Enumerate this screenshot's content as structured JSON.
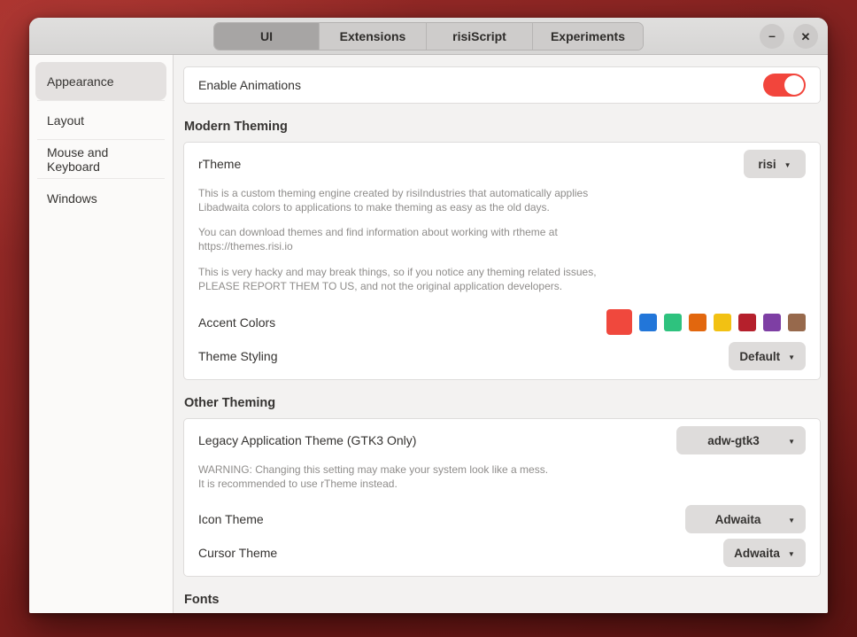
{
  "colors": {
    "accent": "#f2453c",
    "accent_swatches": [
      "#f0483d",
      "#2276d9",
      "#2ec27e",
      "#e2670e",
      "#f2c113",
      "#b5202c",
      "#7e3fa4",
      "#97694c"
    ],
    "accent_selected_index": 0
  },
  "icons": {
    "minimize": "–",
    "close": "✕",
    "dropdown_arrow": "▼"
  },
  "titlebar": {
    "tabs": [
      {
        "label": "UI",
        "active": true
      },
      {
        "label": "Extensions",
        "active": false
      },
      {
        "label": "risiScript",
        "active": false
      },
      {
        "label": "Experiments",
        "active": false
      }
    ]
  },
  "sidebar": {
    "items": [
      {
        "label": "Appearance",
        "selected": true
      },
      {
        "label": "Layout",
        "selected": false
      },
      {
        "label": "Mouse and Keyboard",
        "selected": false
      },
      {
        "label": "Windows",
        "selected": false
      }
    ]
  },
  "content": {
    "enable_animations": {
      "label": "Enable Animations",
      "state": "on"
    },
    "modern_theming": {
      "header": "Modern Theming",
      "rtheme": {
        "label": "rTheme",
        "value": "risi"
      },
      "desc1": "This is a custom theming engine created by risiIndustries that automatically applies\nLibadwaita colors to applications to make theming as easy as the old days.",
      "desc2": "You can download themes and find information about working with rtheme at\nhttps://themes.risi.io",
      "desc3": "This is very hacky and may break things, so if you notice any theming related issues,\nPLEASE REPORT THEM TO US, and not the original application developers.",
      "accent_colors": {
        "label": "Accent Colors"
      },
      "theme_styling": {
        "label": "Theme Styling",
        "value": "Default"
      }
    },
    "other_theming": {
      "header": "Other Theming",
      "legacy": {
        "label": "Legacy Application Theme (GTK3 Only)",
        "value": "adw-gtk3"
      },
      "warning": "WARNING: Changing this setting may make your system look like a mess.\nIt is recommended to use rTheme instead.",
      "icon_theme": {
        "label": "Icon Theme",
        "value": "Adwaita"
      },
      "cursor_theme": {
        "label": "Cursor Theme",
        "value": "Adwaita"
      }
    },
    "fonts_header": "Fonts"
  }
}
